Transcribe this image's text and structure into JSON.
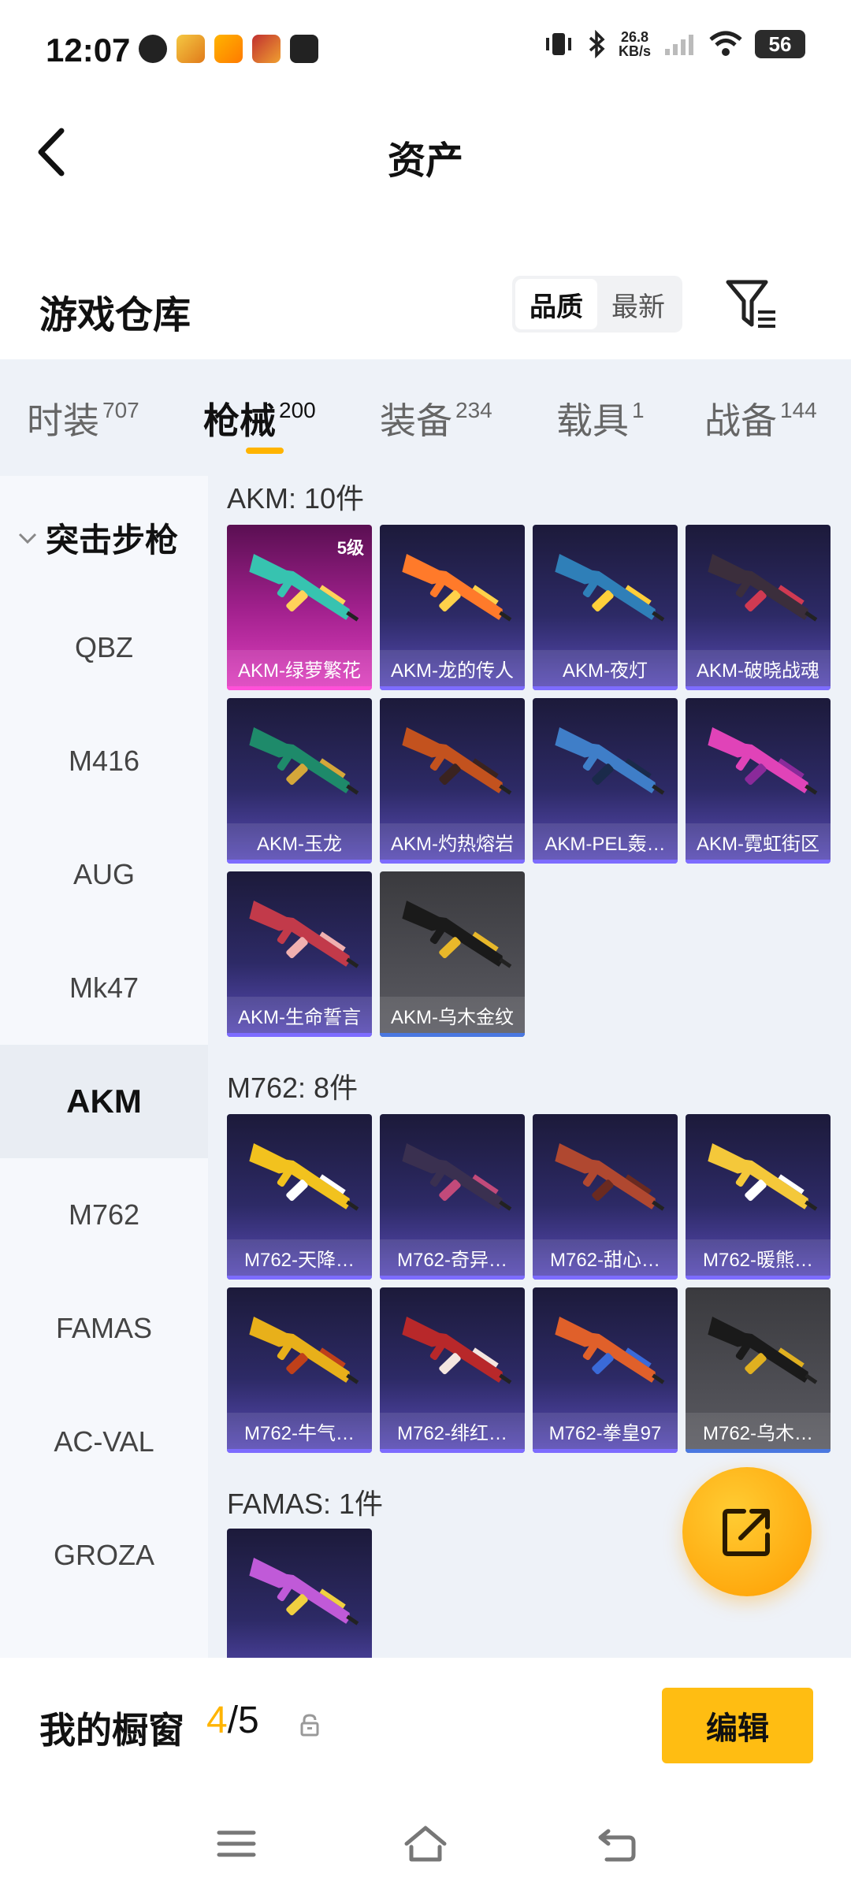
{
  "status_bar": {
    "time": "12:07",
    "net_speed_value": "26.8",
    "net_speed_unit": "KB/s",
    "battery": "56"
  },
  "header": {
    "title": "资产"
  },
  "warehouse": {
    "title": "游戏仓库",
    "sort_options": [
      "品质",
      "最新"
    ],
    "active_sort": "品质"
  },
  "tabs": [
    {
      "label": "时装",
      "count": "707"
    },
    {
      "label": "枪械",
      "count": "200"
    },
    {
      "label": "装备",
      "count": "234"
    },
    {
      "label": "载具",
      "count": "1"
    },
    {
      "label": "战备",
      "count": "144"
    }
  ],
  "active_tab": "枪械",
  "sidebar": {
    "category": "突击步枪",
    "items": [
      "QBZ",
      "M416",
      "AUG",
      "Mk47",
      "AKM",
      "M762",
      "FAMAS",
      "AC-VAL",
      "GROZA"
    ],
    "active": "AKM"
  },
  "groups": [
    {
      "title": "AKM: 10件",
      "items": [
        {
          "label": "AKM-绿萝繁花",
          "level": "5级",
          "tier": "pink",
          "gun_color": "#37c3b0",
          "accent": "#ffd35a"
        },
        {
          "label": "AKM-龙的传人",
          "tier": "purple",
          "gun_color": "#ff7a2a",
          "accent": "#ffd14a"
        },
        {
          "label": "AKM-夜灯",
          "tier": "purple",
          "gun_color": "#2f7fb8",
          "accent": "#ffcf3a"
        },
        {
          "label": "AKM-破晓战魂",
          "tier": "purple",
          "gun_color": "#3b2e3c",
          "accent": "#d03a52"
        },
        {
          "label": "AKM-玉龙",
          "tier": "purple",
          "gun_color": "#1e8a6a",
          "accent": "#d4a73a"
        },
        {
          "label": "AKM-灼热熔岩",
          "tier": "purple",
          "gun_color": "#c3521e",
          "accent": "#3a2320"
        },
        {
          "label": "AKM-PEL轰…",
          "tier": "purple",
          "gun_color": "#3f7ec8",
          "accent": "#1a2a4a"
        },
        {
          "label": "AKM-霓虹街区",
          "tier": "purple",
          "gun_color": "#e043b8",
          "accent": "#8a2a9a"
        },
        {
          "label": "AKM-生命誓言",
          "tier": "purple",
          "gun_color": "#c23a4a",
          "accent": "#f0b0b0"
        },
        {
          "label": "AKM-乌木金纹",
          "tier": "gray",
          "gun_color": "#1a1a1a",
          "accent": "#e8b82a"
        }
      ]
    },
    {
      "title": "M762: 8件",
      "items": [
        {
          "label": "M762-天降…",
          "tier": "purple",
          "gun_color": "#f2c21e",
          "accent": "#ffffff"
        },
        {
          "label": "M762-奇异…",
          "tier": "purple",
          "gun_color": "#3a3050",
          "accent": "#c24a7a"
        },
        {
          "label": "M762-甜心…",
          "tier": "purple",
          "gun_color": "#b04830",
          "accent": "#6a2a20"
        },
        {
          "label": "M762-暖熊…",
          "tier": "purple",
          "gun_color": "#f4c83a",
          "accent": "#ffffff"
        },
        {
          "label": "M762-牛气…",
          "tier": "purple",
          "gun_color": "#e8b01a",
          "accent": "#c0401a"
        },
        {
          "label": "M762-绯红…",
          "tier": "purple",
          "gun_color": "#b8282a",
          "accent": "#f4e6e0"
        },
        {
          "label": "M762-拳皇97",
          "tier": "purple",
          "gun_color": "#e0602a",
          "accent": "#3a6ad8"
        },
        {
          "label": "M762-乌木…",
          "tier": "gray",
          "gun_color": "#1a1a1a",
          "accent": "#e0b020"
        }
      ]
    },
    {
      "title": "FAMAS: 1件",
      "items": [
        {
          "label": "",
          "tier": "purple",
          "gun_color": "#c05ad8",
          "accent": "#f0d040"
        }
      ]
    }
  ],
  "showcase": {
    "label": "我的橱窗",
    "current": "4",
    "separator": "/",
    "total": "5",
    "edit_label": "编辑"
  }
}
